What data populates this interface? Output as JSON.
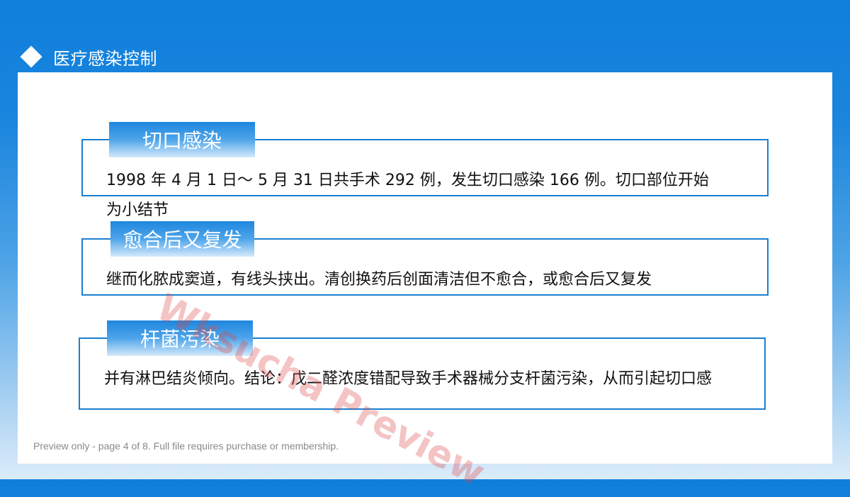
{
  "header": {
    "icon": "diamond-icon",
    "title": "医疗感染控制"
  },
  "sections": [
    {
      "tag": "切口感染",
      "text_lines": [
        "1998 年 4 月 1 日～ 5 月 31 日共手术 292 例，发生切口感染 166 例。切口部位开始",
        "为小结节"
      ]
    },
    {
      "tag": "愈合后又复发",
      "text_lines": [
        "继而化脓成窦道，有线头挟出。清创换药后创面清洁但不愈合，或愈合后又复发"
      ]
    },
    {
      "tag": "杆菌污染",
      "text_lines": [
        "并有淋巴结炎倾向。结论：戊二醛浓度错配导致手术器械分支杆菌污染，从而引起切口感"
      ]
    }
  ],
  "watermark": "Wksucha Preview",
  "footer": {
    "note": "Preview only - page 4 of 8. Full file requires purchase or membership."
  },
  "colors": {
    "accent": "#1a7fd0",
    "background_top": "#0f7fdc",
    "watermark": "#dc4646"
  }
}
